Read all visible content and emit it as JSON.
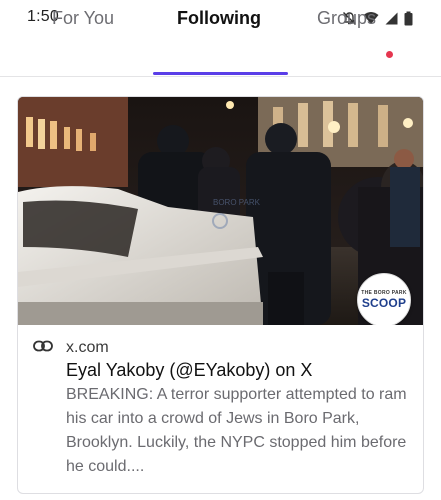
{
  "status_bar": {
    "time": "1:50",
    "icons": [
      "mute-icon",
      "wifi-icon",
      "signal-icon",
      "battery-icon"
    ]
  },
  "tabs": {
    "items": [
      {
        "label": "For You",
        "active": false
      },
      {
        "label": "Following",
        "active": true
      },
      {
        "label": "Groups",
        "active": false,
        "has_notification_dot": true
      }
    ],
    "accent_color": "#5a3ee8",
    "dot_color": "#e5364f"
  },
  "link_card": {
    "domain": "x.com",
    "title": "Eyal Yakoby (@EYakoby) on X",
    "description": "BREAKING: A terror supporter attempted to ram his car into a crowd of Jews in Boro Park, Brooklyn. Luckily, the NYPC stopped him before he could....",
    "image": {
      "watermark": "BORO PARK",
      "logo": {
        "small_text": "THE BORO PARK",
        "main_text": "SCOOP"
      }
    },
    "icon": "link-icon"
  }
}
